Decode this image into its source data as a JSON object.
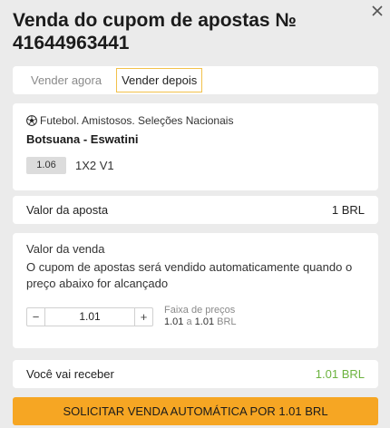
{
  "dialog": {
    "title": "Venda do cupom de apostas № 41644963441"
  },
  "tabs": [
    {
      "label": "Vender agora",
      "active": false
    },
    {
      "label": "Vender depois",
      "active": true
    }
  ],
  "event": {
    "sport_icon": "soccer-ball-icon",
    "league": "Futebol. Amistosos. Seleções Nacionais",
    "teams": "Botsuana - Eswatini",
    "odds": "1.06",
    "market": "1X2 V1"
  },
  "stake": {
    "label": "Valor da aposta",
    "value": "1 BRL"
  },
  "sale": {
    "title": "Valor da venda",
    "description": "O cupom de apostas será vendido automaticamente quando o preço abaixo for alcançado",
    "stepper": {
      "minus": "−",
      "plus": "+",
      "value": "1.01"
    },
    "range": {
      "label": "Faixa de preços",
      "from": "1.01",
      "to_word": "a",
      "to": "1.01",
      "currency": "BRL"
    }
  },
  "receive": {
    "label": "Você vai receber",
    "value": "1.01 BRL"
  },
  "cta": {
    "label": "SOLICITAR VENDA AUTOMÁTICA POR 1.01 BRL"
  },
  "colors": {
    "accent": "#f6a623",
    "tab_border": "#f2c14b",
    "positive": "#6cb33f"
  }
}
